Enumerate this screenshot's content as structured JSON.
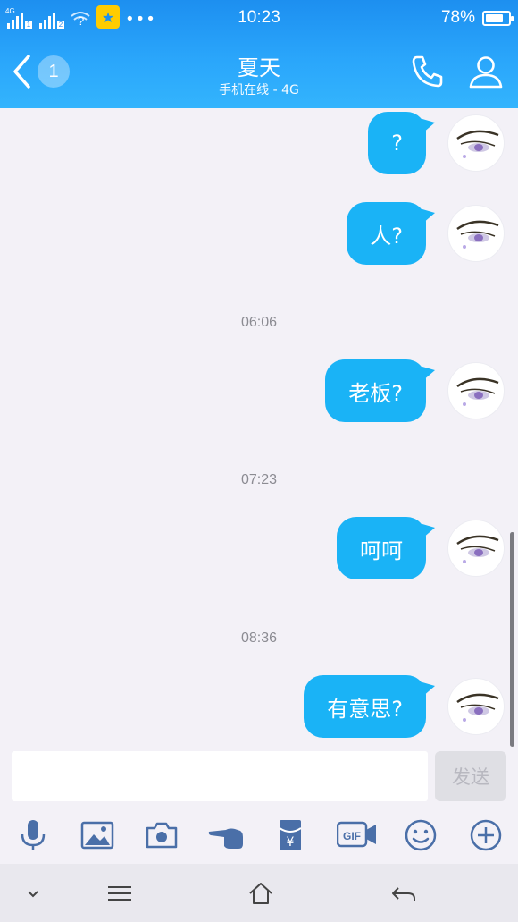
{
  "status_bar": {
    "network_tag": "4G",
    "sim1": "1",
    "sim2": "2",
    "wifi_mark": "?",
    "time": "10:23",
    "battery": "78%",
    "battery_level": 0.78
  },
  "header": {
    "unread_count": "1",
    "contact_name": "夏天",
    "contact_status": "手机在线 - 4G"
  },
  "chat": {
    "messages": [
      {
        "text": "?"
      },
      {
        "text": "人?"
      },
      {
        "text": "老板?"
      },
      {
        "text": "呵呵"
      },
      {
        "text": "有意思?"
      }
    ],
    "timestamps": [
      "06:06",
      "07:23",
      "08:36"
    ]
  },
  "input": {
    "value": "",
    "placeholder": "",
    "send_label": "发送"
  },
  "toolbar": {
    "items": [
      "mic-icon",
      "image-icon",
      "camera-icon",
      "poke-icon",
      "red-packet-icon",
      "gif-icon",
      "emoji-icon",
      "plus-icon"
    ],
    "gif_label": "GIF",
    "yen_label": "¥"
  },
  "navbar": {
    "items": [
      "chevron-down-icon",
      "menu-icon",
      "home-icon",
      "back-icon"
    ]
  },
  "colors": {
    "header_top": "#1d8ff0",
    "header_bottom": "#33b4fd",
    "bubble": "#1ab3f6",
    "background": "#f3f1f7",
    "toolbar_icon": "#4a6fa8"
  }
}
